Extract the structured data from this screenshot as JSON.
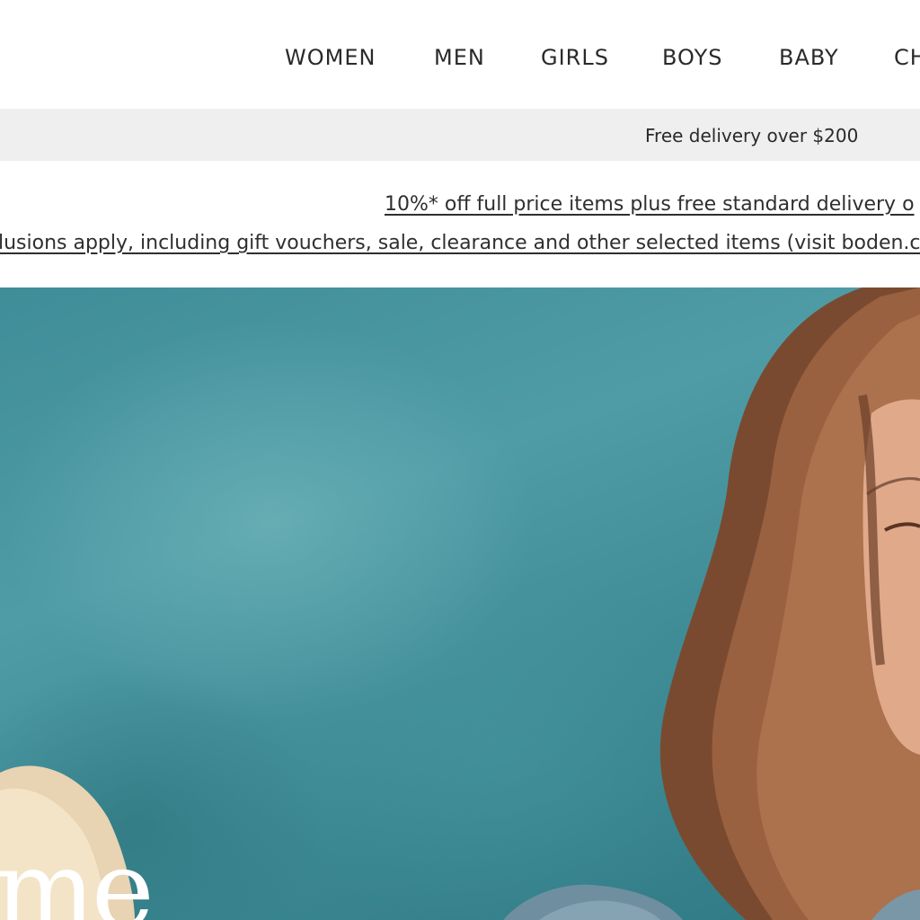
{
  "nav": {
    "items": [
      {
        "label": "WOMEN"
      },
      {
        "label": "MEN"
      },
      {
        "label": "GIRLS"
      },
      {
        "label": "BOYS"
      },
      {
        "label": "BABY"
      },
      {
        "label": "CH"
      }
    ]
  },
  "delivery_bar": {
    "text": "Free delivery over $200",
    "background": "#efefef"
  },
  "promo": {
    "line1": "10%* off full price items plus free standard delivery o",
    "line2": "lusions apply, including gift vouchers, sale, clearance and other selected items (visit boden.c"
  },
  "hero": {
    "script_text": "me",
    "background": "#4a97a1"
  }
}
